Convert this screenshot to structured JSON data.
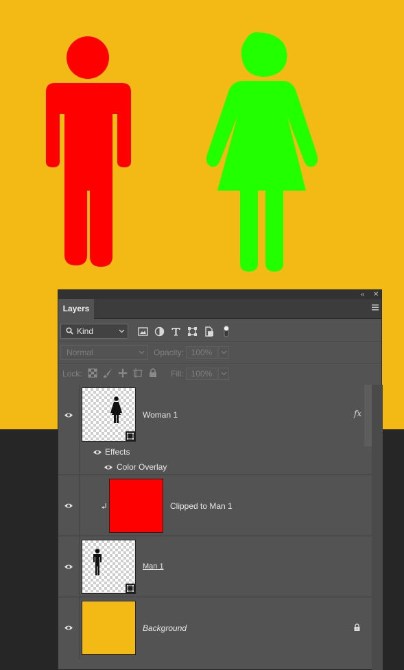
{
  "canvas": {
    "background": "#f3b915",
    "man_color": "#ff0000",
    "woman_color": "#22ff00"
  },
  "panel": {
    "tab_label": "Layers",
    "filter": {
      "kind_label": "Kind",
      "icons": [
        "image-filter-icon",
        "adjustment-filter-icon",
        "type-filter-icon",
        "shape-filter-icon",
        "smart-object-filter-icon",
        "filter-toggle-icon"
      ]
    },
    "blend_mode": "Normal",
    "opacity_label": "Opacity:",
    "opacity_value": "100%",
    "lock_label": "Lock:",
    "fill_label": "Fill:",
    "fill_value": "100%",
    "layers": [
      {
        "name": "Woman 1",
        "fx": "fx",
        "effects_label": "Effects",
        "effect": "Color Overlay"
      },
      {
        "name": "Clipped to Man 1",
        "fill": "#ff0000"
      },
      {
        "name": "Man 1"
      },
      {
        "name": "Background",
        "fill": "#f3b915"
      }
    ]
  }
}
